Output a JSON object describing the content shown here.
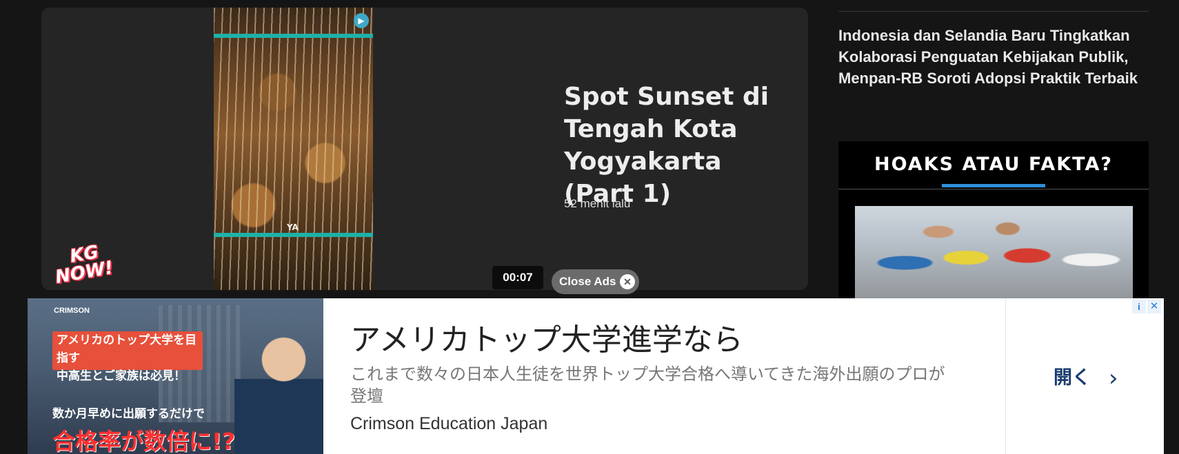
{
  "video_ad": {
    "title": "Spot Sunset di Tengah Kota Yogyakarta (Part 1)",
    "time_ago": "52 menit lalu",
    "timer": "00:07",
    "close_label": "Close Ads",
    "logo_line1": "KG",
    "logo_line2": "NOW!",
    "thumb_watermark": "YA"
  },
  "sidebar": {
    "article_title": "Indonesia dan Selandia Baru Tingkatkan Kolaborasi Penguatan Kebijakan Publik, Menpan-RB Soroti Adopsi Praktik Terbaik",
    "section_title": "HOAKS ATAU FAKTA?"
  },
  "ad_banner": {
    "image_brand": "CRIMSON",
    "image_red_line1": "アメリカのトップ大学を目指す",
    "image_red_line2": "中高生とご家族は必見！",
    "image_sub1": "数か月早めに出願するだけで",
    "image_sub2": "合格率が数倍に!?",
    "headline": "アメリカトップ大学進学なら",
    "description": "これまで数々の日本人生徒を世界トップ大学合格へ導いてきた海外出願のプロが登壇",
    "advertiser": "Crimson Education Japan",
    "cta": "開く"
  },
  "colors": {
    "page_bg": "#151515",
    "card_bg": "#252525",
    "accent_blue": "#2d8fd9",
    "cta_blue": "#1a3c6e"
  }
}
